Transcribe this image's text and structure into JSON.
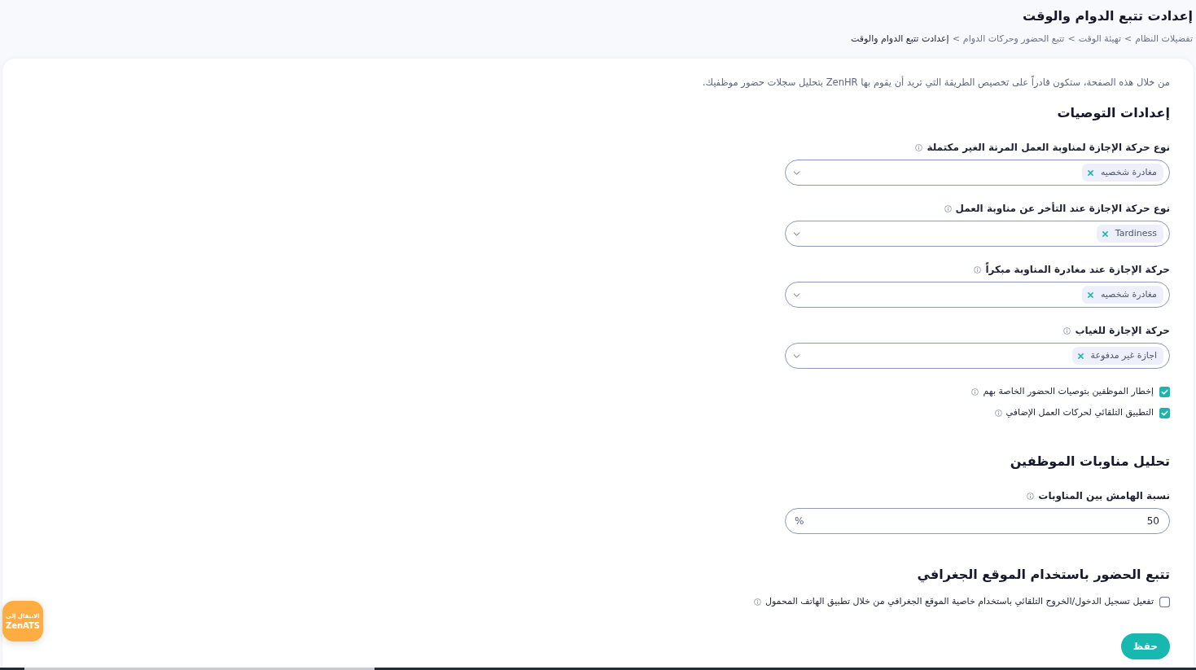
{
  "header": {
    "title": "إعدادت تتبع الدوام والوقت",
    "breadcrumb": [
      {
        "kind": "link",
        "label": "تفضيلات النظام"
      },
      {
        "kind": "separator",
        "label": "<"
      },
      {
        "kind": "link",
        "label": "تهيئة الوقت"
      },
      {
        "kind": "separator",
        "label": "<"
      },
      {
        "kind": "link",
        "label": "تتبع الحضور وحركات الدوام"
      },
      {
        "kind": "separator",
        "label": "<"
      },
      {
        "kind": "current",
        "label": "إعدادت تتبع الدوام والوقت"
      }
    ]
  },
  "intro": "من خلال هذه الصفحة، ستكون قادراً على تخصيص الطريقة التي تريد أن يقوم بها ZenHR بتحليل سجلات حضور موظفيك.",
  "sections": [
    {
      "title": "إعدادات التوصيات",
      "fields": [
        {
          "kind": "select",
          "label": "نوع حركة الإجازة لمناوبة العمل المرنة الغير مكتملة",
          "info": true,
          "chips": [
            "مغادرة شخصيه"
          ]
        },
        {
          "kind": "select",
          "label": "نوع حركة الإجازة عند التأخر عن مناوبة العمل",
          "info": true,
          "chips": [
            "Tardiness"
          ]
        },
        {
          "kind": "select",
          "label": "حركة الإجازة عند مغادرة المناوبة مبكراً",
          "info": true,
          "chips": [
            "مغادرة شخصيه"
          ]
        },
        {
          "kind": "select",
          "label": "حركة الإجازة للغياب",
          "info": true,
          "chips": [
            "اجازة غير مدفوعة"
          ]
        },
        {
          "kind": "checkbox",
          "label": "إخطار الموظفين بتوصيات الحضور الخاصة بهم",
          "info": true,
          "checked": true
        },
        {
          "kind": "checkbox",
          "label": "التطبيق التلقائي لحركات العمل الإضافي",
          "info": true,
          "checked": true
        }
      ]
    },
    {
      "title": "تحليل مناوبات الموظفين",
      "fields": [
        {
          "kind": "number",
          "label": "نسبة الهامش بين المناوبات",
          "info": true,
          "value": "50",
          "suffix": "%"
        }
      ]
    },
    {
      "title": "تتبع الحضور باستخدام الموقع الجغرافي",
      "fields": [
        {
          "kind": "checkbox",
          "label": "تفعيل تسجيل الدخول/الخروج التلقائي باستخدام خاصية الموقع الجغرافي من خلال تطبيق الهاتف المحمول",
          "info": true,
          "checked": false
        }
      ]
    }
  ],
  "save_button": "حفظ",
  "floating_button": {
    "line_1": "الانتقال إلى",
    "line_2": "ZenATS"
  }
}
